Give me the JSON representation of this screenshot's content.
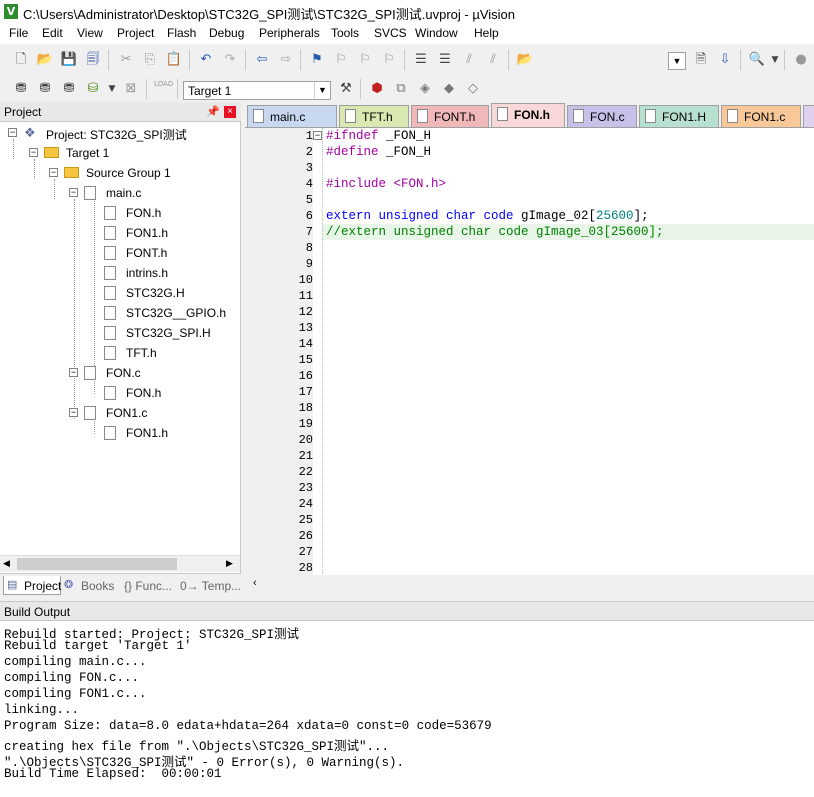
{
  "window": {
    "title": "C:\\Users\\Administrator\\Desktop\\STC32G_SPI测试\\STC32G_SPI测试.uvproj - µVision",
    "app_icon": "V"
  },
  "menu": [
    "File",
    "Edit",
    "View",
    "Project",
    "Flash",
    "Debug",
    "Peripherals",
    "Tools",
    "SVCS",
    "Window",
    "Help"
  ],
  "toolbar2": {
    "target": "Target 1"
  },
  "project_pane": {
    "title": "Project",
    "tree": [
      {
        "label": "Project: STC32G_SPI测试"
      },
      {
        "label": "Target 1"
      },
      {
        "label": "Source Group 1"
      },
      {
        "label": "main.c"
      },
      {
        "label": "FON.h"
      },
      {
        "label": "FON1.h"
      },
      {
        "label": "FONT.h"
      },
      {
        "label": "intrins.h"
      },
      {
        "label": "STC32G.H"
      },
      {
        "label": "STC32G__GPIO.h"
      },
      {
        "label": "STC32G_SPI.H"
      },
      {
        "label": "TFT.h"
      },
      {
        "label": "FON.c"
      },
      {
        "label": "FON.h"
      },
      {
        "label": "FON1.c"
      },
      {
        "label": "FON1.h"
      }
    ],
    "tabs": [
      "Project",
      "Books",
      "{} Func...",
      "0→ Temp..."
    ]
  },
  "editor_tabs": [
    {
      "label": "main.c",
      "color": "#c8d8f0",
      "active": false
    },
    {
      "label": "TFT.h",
      "color": "#d8e8b0",
      "active": false
    },
    {
      "label": "FONT.h",
      "color": "#f0b8b8",
      "active": false
    },
    {
      "label": "FON.h",
      "color": "#f8d8d8",
      "active": true
    },
    {
      "label": "FON.c",
      "color": "#c8c0e8",
      "active": false
    },
    {
      "label": "FON1.H",
      "color": "#b8e0d0",
      "active": false
    },
    {
      "label": "FON1.c",
      "color": "#f8c898",
      "active": false
    }
  ],
  "editor": {
    "line_numbers": [
      "1",
      "2",
      "3",
      "4",
      "5",
      "6",
      "7",
      "8",
      "9",
      "10",
      "11",
      "12",
      "13",
      "14",
      "15",
      "16",
      "17",
      "18",
      "19",
      "20",
      "21",
      "22",
      "23",
      "24",
      "25",
      "26",
      "27",
      "28"
    ],
    "code": {
      "l1_a": "#ifndef",
      "l1_b": " _FON_H",
      "l2_a": "#define",
      "l2_b": " _FON_H",
      "l4_a": "#include",
      "l4_b": " <FON.h>",
      "l6_a": "extern unsigned char code",
      "l6_b": " gImage_02[",
      "l6_c": "25600",
      "l6_d": "];",
      "l7": "//extern unsigned char code gImage_03[25600];"
    }
  },
  "build_output": {
    "title": "Build Output",
    "lines": [
      "Rebuild started: Project: STC32G_SPI测试",
      "Rebuild target 'Target 1'",
      "compiling main.c...",
      "compiling FON.c...",
      "compiling FON1.c...",
      "linking...",
      "Program Size: data=8.0 edata+hdata=264 xdata=0 const=0 code=53679",
      "creating hex file from \".\\Objects\\STC32G_SPI测试\"...",
      "\".\\Objects\\STC32G_SPI测试\" - 0 Error(s), 0 Warning(s).",
      "Build Time Elapsed:  00:00:01"
    ]
  }
}
